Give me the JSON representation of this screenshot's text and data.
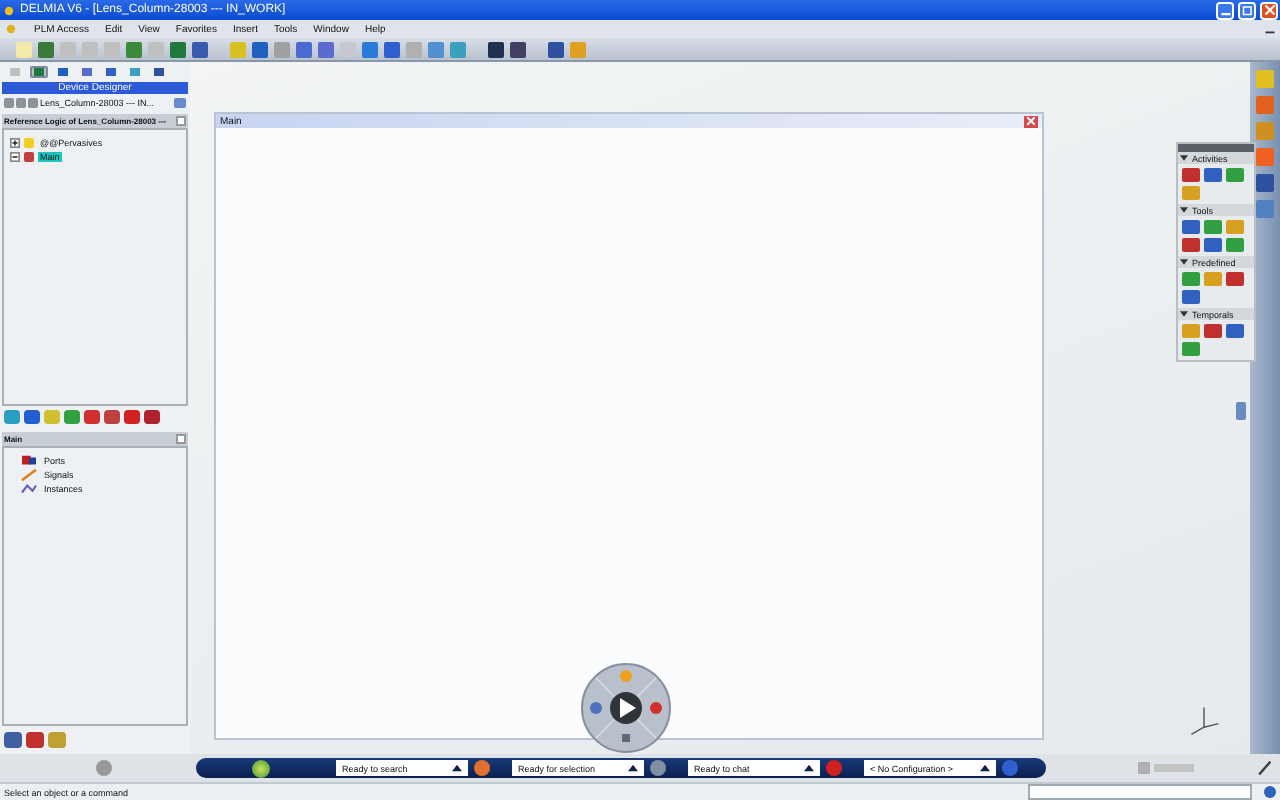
{
  "window": {
    "title": "DELMIA V6 - [Lens_Column-28003 --- IN_WORK]"
  },
  "menu": [
    "PLM Access",
    "Edit",
    "View",
    "Favorites",
    "Insert",
    "Tools",
    "Window",
    "Help"
  ],
  "workbench_tabs": [
    {
      "selected": false
    },
    {
      "selected": true
    },
    {
      "selected": false
    },
    {
      "selected": false
    },
    {
      "selected": false
    },
    {
      "selected": false
    },
    {
      "selected": false
    }
  ],
  "left_panel": {
    "workbench": "Device Designer",
    "object_field": "Lens_Column-28003 --- IN...",
    "logic_header": "Reference Logic of Lens_Column-28003 ---",
    "logic_tree": [
      {
        "label": "@@Pervasives",
        "selected": false,
        "expanded": false
      },
      {
        "label": "Main",
        "selected": true,
        "expanded": true
      }
    ],
    "main_header": "Main",
    "main_tree": [
      {
        "label": "Ports",
        "kind": "ports"
      },
      {
        "label": "Signals",
        "kind": "signals"
      },
      {
        "label": "Instances",
        "kind": "instances"
      }
    ]
  },
  "editor": {
    "title": "Main"
  },
  "palette": [
    {
      "title": "Activities",
      "expanded": true
    },
    {
      "title": "Tools",
      "expanded": true
    },
    {
      "title": "Predefined",
      "expanded": true
    },
    {
      "title": "Temporals",
      "expanded": true
    }
  ],
  "compass_fields": [
    {
      "value": "Ready to search"
    },
    {
      "value": "Ready for selection"
    },
    {
      "value": "Ready to chat"
    },
    {
      "value": "< No Configuration >"
    }
  ],
  "status_bar": {
    "message": "Select an object or a command"
  }
}
